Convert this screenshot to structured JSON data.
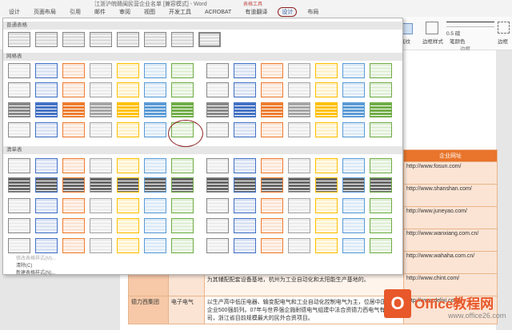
{
  "window": {
    "title": "江浙沪皖赣闽民营企业名单 [兼容模式] - Word",
    "tool_group": "表格工具"
  },
  "tabs": [
    "设计",
    "页面布局",
    "引用",
    "邮件",
    "审阅",
    "视图",
    "开发工具",
    "ACROBAT",
    "有道翻译",
    "设计",
    "布局"
  ],
  "ribbon_right": {
    "shading": "底纹",
    "border_styles": "边框样式",
    "pen_color": "笔颜色",
    "line_weight": "0.5 磅",
    "borders": "边框",
    "group": "边框"
  },
  "gallery": {
    "sections": [
      "普通表格",
      "网格表",
      "清单表"
    ],
    "footer": [
      "修改表格样式(M)...",
      "清除(C)",
      "新建表格样式(N)..."
    ]
  },
  "table": {
    "header": "企业网址",
    "rows": [
      {
        "name": "",
        "product": "",
        "desc": "产、",
        "url": "http://www.fosun.com/"
      },
      {
        "name": "",
        "product": "",
        "desc": "500",
        "url": "http://www.shanshan.com/"
      },
      {
        "name": "",
        "product": "",
        "desc": "观",
        "url": "http://www.juneyao.com/"
      },
      {
        "name": "",
        "product": "",
        "desc": "",
        "url": "http://www.wanxiang.com.cn/"
      },
      {
        "name": "",
        "product": "",
        "desc": "68",
        "url": "http://www.wahaha.com.cn/"
      },
      {
        "name": "",
        "product": "",
        "desc": "为其辅配配套设备基地，杭州为工业自动化和太阳能生产基地的。",
        "url": "http://www.chint.com/"
      },
      {
        "name": "德力西集团",
        "product": "电子电气",
        "desc": "以生产高中低压电器、输变配电气和工业自动化控制电气为主，位居中国民营企业500强前列。07年与世界强企施耐德电气组建中法合资德力西电气有限公司，浙江省目前规模最大的民外合资项目。",
        "url": "http://www.delixi.com/"
      }
    ]
  },
  "watermark": {
    "logo": "O",
    "title": "Office教程网",
    "url": "www.office26.com"
  }
}
